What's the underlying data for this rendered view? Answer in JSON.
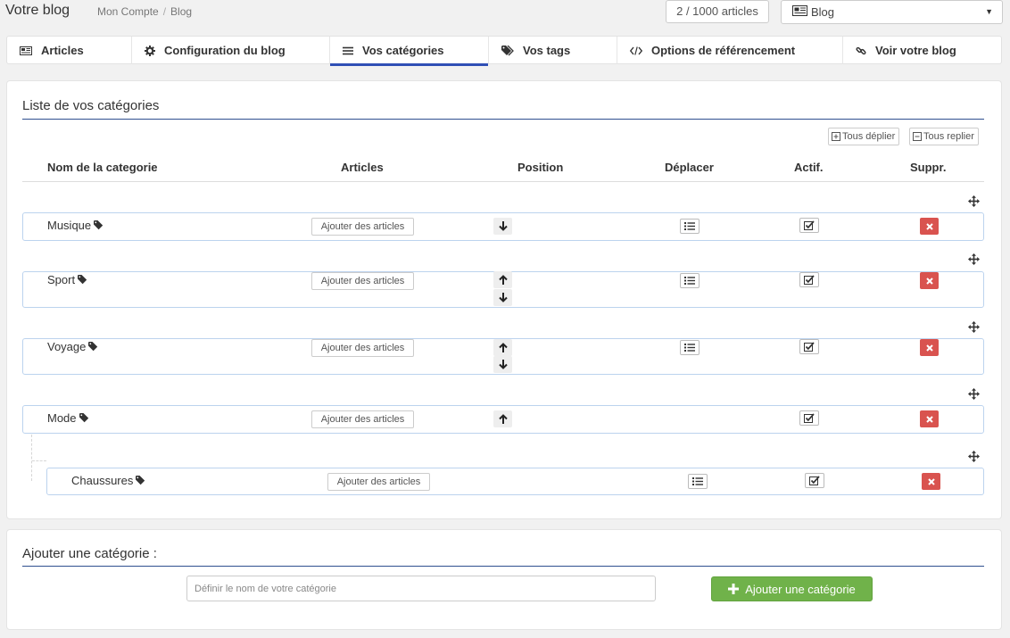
{
  "header": {
    "title": "Votre blog",
    "breadcrumb": [
      "Mon Compte",
      "Blog"
    ],
    "article_count": "2 / 1000 articles",
    "blog_select": "Blog"
  },
  "tabs": [
    {
      "label": "Articles",
      "icon": "newspaper-icon"
    },
    {
      "label": "Configuration du blog",
      "icon": "gear-icon"
    },
    {
      "label": "Vos catégories",
      "icon": "list-icon",
      "active": true
    },
    {
      "label": "Vos tags",
      "icon": "tags-icon"
    },
    {
      "label": "Options de référencement",
      "icon": "code-icon"
    },
    {
      "label": "Voir votre blog",
      "icon": "link-icon"
    }
  ],
  "categories_panel": {
    "title": "Liste de vos catégories",
    "expand_all": "Tous déplier",
    "collapse_all": "Tous replier",
    "columns": [
      "Nom de la categorie",
      "Articles",
      "Position",
      "Déplacer",
      "Actif.",
      "Suppr."
    ],
    "add_articles_label": "Ajouter des articles",
    "rows": [
      {
        "name": "Musique",
        "up": false,
        "down": true,
        "active": true
      },
      {
        "name": "Sport",
        "up": true,
        "down": true,
        "active": true
      },
      {
        "name": "Voyage",
        "up": true,
        "down": true,
        "active": true
      },
      {
        "name": "Mode",
        "up": true,
        "down": false,
        "active": true
      },
      {
        "name": "Chaussures",
        "up": false,
        "down": false,
        "active": true,
        "child_of": "Mode"
      }
    ]
  },
  "add_panel": {
    "title": "Ajouter une catégorie :",
    "placeholder": "Définir le nom de votre catégorie",
    "button_label": "Ajouter une catégorie"
  },
  "colors": {
    "accent": "#2f4fb5",
    "row_border": "#bcd3ee",
    "delete": "#d9534f",
    "success": "#70b24a"
  }
}
